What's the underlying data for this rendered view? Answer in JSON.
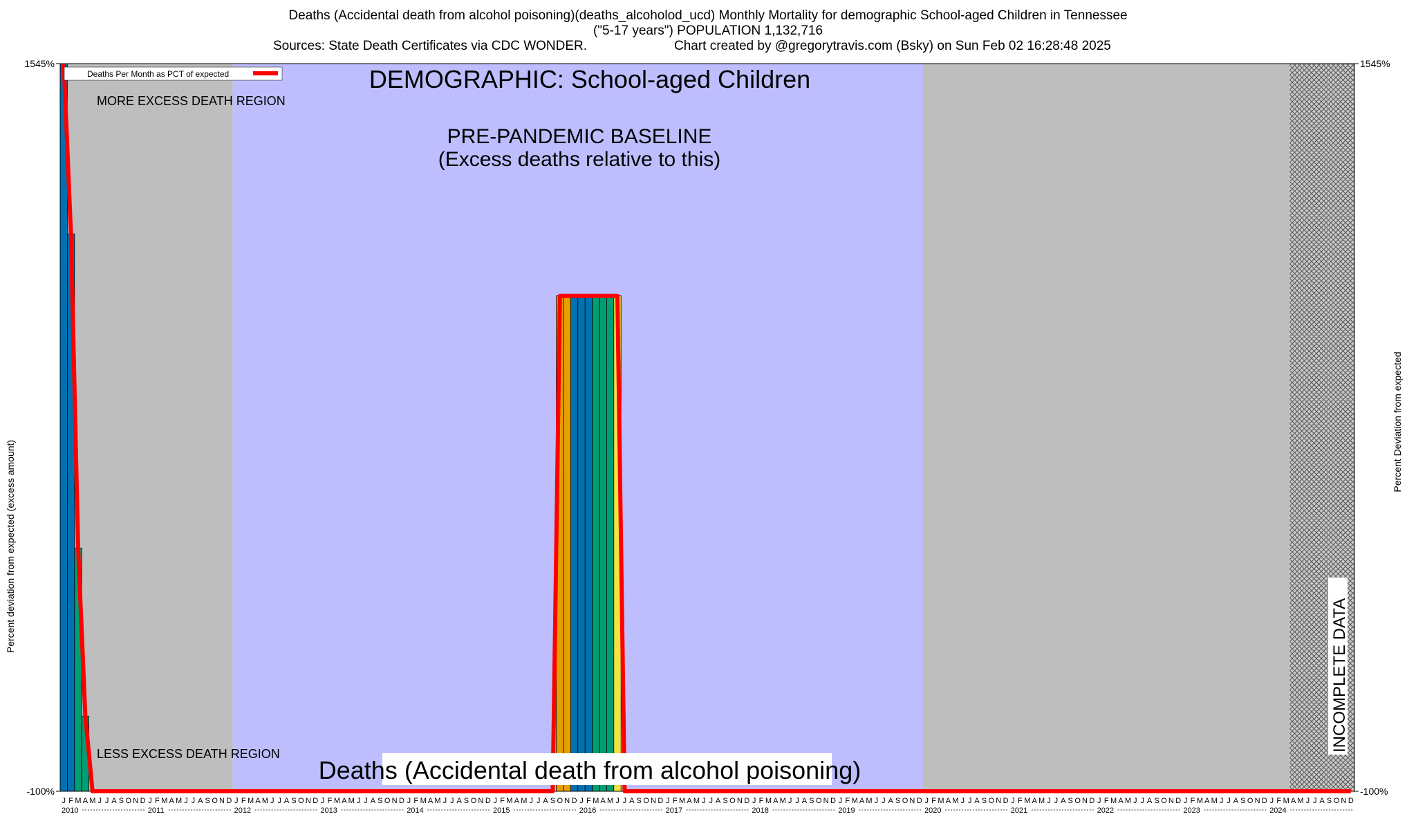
{
  "header": {
    "line1": "Deaths (Accidental death from alcohol poisoning)(deaths_alcoholod_ucd) Monthly Mortality for demographic School-aged Children in Tennessee",
    "line2": "(\"5-17 years\") POPULATION 1,132,716",
    "line3_left": "Sources: State Death Certificates via CDC WONDER.",
    "line3_right": "Chart created by @gregorytravis.com (Bsky) on Sun Feb 02 16:28:48 2025"
  },
  "colors": {
    "grey_region": "#bebebe",
    "baseline_region": "#bebeff",
    "line": "#ff0000",
    "winter": "#0072b2",
    "spring": "#009e73",
    "summer": "#f0e442",
    "autumn": "#e69f00"
  },
  "chart_data": {
    "type": "bar",
    "title": "DEMOGRAPHIC: School-aged Children",
    "subtitle": "Deaths (Accidental death from alcohol poisoning)",
    "ylabel_left": "Percent deviation from expected (excess amount)",
    "ylabel_right": "Percent Deviation from expected",
    "legend": {
      "label": "Deaths Per Month as PCT of expected",
      "placement": "top-left"
    },
    "ylim": [
      -100,
      1545
    ],
    "y_ticks_shown": [
      "1545%",
      "-100%"
    ],
    "x_start": "2010-01",
    "x_end": "2024-12",
    "month_letters": [
      "J",
      "F",
      "M",
      "A",
      "M",
      "J",
      "J",
      "A",
      "S",
      "O",
      "N",
      "D"
    ],
    "years": [
      "2010",
      "2011",
      "2012",
      "2013",
      "2014",
      "2015",
      "2016",
      "2017",
      "2018",
      "2019",
      "2020",
      "2021",
      "2022",
      "2023",
      "2024"
    ],
    "regions": [
      {
        "label": "MORE EXCESS DEATH REGION",
        "start": "2010-01",
        "end": "2011-12",
        "fill": "grey"
      },
      {
        "label": "PRE-PANDEMIC BASELINE",
        "label2": "(Excess deaths relative to this)",
        "start": "2012-01",
        "end": "2019-12",
        "fill": "baseline"
      },
      {
        "label": "",
        "start": "2020-01",
        "end": "2024-03",
        "fill": "grey"
      },
      {
        "label": "INCOMPLETE DATA",
        "start": "2024-04",
        "end": "2024-12",
        "fill": "hatched"
      }
    ],
    "less_excess_label": "LESS EXCESS DEATH REGION",
    "series": [
      {
        "name": "Deaths Per Month as PCT of expected",
        "x_start": "2010-01",
        "values": [
          1545,
          1160,
          450,
          70,
          -100,
          -100,
          -100,
          -100,
          -100,
          -100,
          -100,
          -100,
          -100,
          -100,
          -100,
          -100,
          -100,
          -100,
          -100,
          -100,
          -100,
          -100,
          -100,
          -100,
          -100,
          -100,
          -100,
          -100,
          -100,
          -100,
          -100,
          -100,
          -100,
          -100,
          -100,
          -100,
          -100,
          -100,
          -100,
          -100,
          -100,
          -100,
          -100,
          -100,
          -100,
          -100,
          -100,
          -100,
          -100,
          -100,
          -100,
          -100,
          -100,
          -100,
          -100,
          -100,
          -100,
          -100,
          -100,
          -100,
          -100,
          -100,
          -100,
          -100,
          -100,
          -100,
          -100,
          -100,
          -100,
          1020,
          1020,
          1020,
          1020,
          1020,
          1020,
          1020,
          1020,
          1020,
          -100,
          -100,
          -100,
          -100,
          -100,
          -100,
          -100,
          -100,
          -100,
          -100,
          -100,
          -100,
          -100,
          -100,
          -100,
          -100,
          -100,
          -100,
          -100,
          -100,
          -100,
          -100,
          -100,
          -100,
          -100,
          -100,
          -100,
          -100,
          -100,
          -100,
          -100,
          -100,
          -100,
          -100,
          -100,
          -100,
          -100,
          -100,
          -100,
          -100,
          -100,
          -100,
          -100,
          -100,
          -100,
          -100,
          -100,
          -100,
          -100,
          -100,
          -100,
          -100,
          -100,
          -100,
          -100,
          -100,
          -100,
          -100,
          -100,
          -100,
          -100,
          -100,
          -100,
          -100,
          -100,
          -100,
          -100,
          -100,
          -100,
          -100,
          -100,
          -100,
          -100,
          -100,
          -100,
          -100,
          -100,
          -100,
          -100,
          -100,
          -100,
          -100,
          -100,
          -100,
          -100,
          -100,
          -100,
          -100,
          -100,
          -100,
          -100,
          -100,
          -100,
          -100,
          -100,
          -100,
          -100,
          -100,
          -100,
          -100,
          -100,
          -100
        ]
      }
    ]
  }
}
